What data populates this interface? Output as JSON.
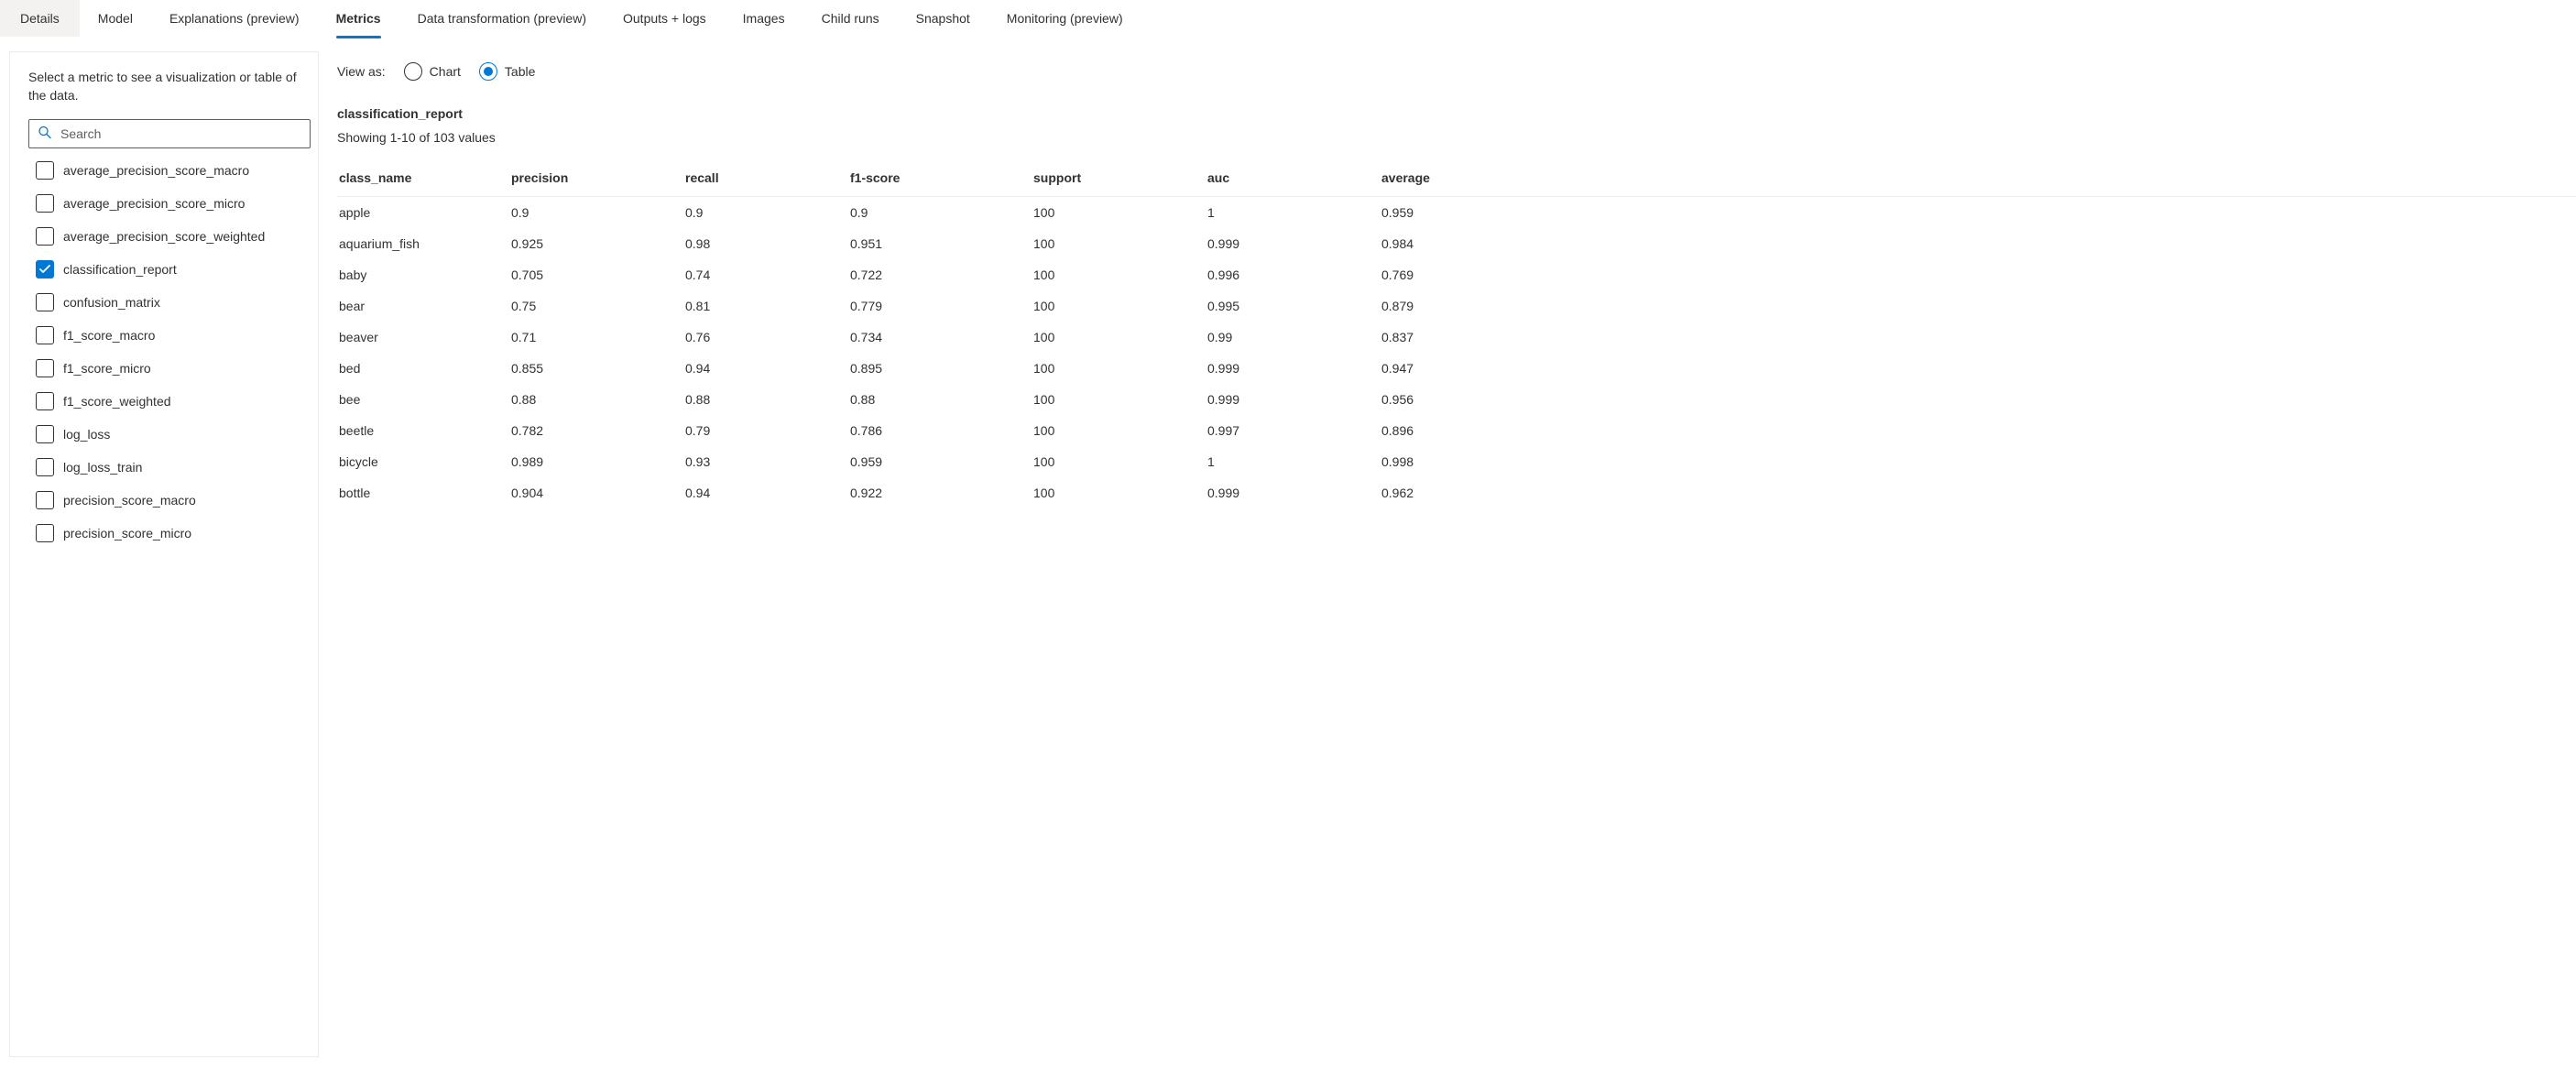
{
  "tabs": [
    {
      "label": "Details",
      "active": false,
      "bg": true
    },
    {
      "label": "Model",
      "active": false
    },
    {
      "label": "Explanations (preview)",
      "active": false
    },
    {
      "label": "Metrics",
      "active": true
    },
    {
      "label": "Data transformation (preview)",
      "active": false
    },
    {
      "label": "Outputs + logs",
      "active": false
    },
    {
      "label": "Images",
      "active": false
    },
    {
      "label": "Child runs",
      "active": false
    },
    {
      "label": "Snapshot",
      "active": false
    },
    {
      "label": "Monitoring (preview)",
      "active": false
    }
  ],
  "sidebar": {
    "title": "Select a metric to see a visualization or table of the data.",
    "search_placeholder": "Search",
    "metrics": [
      {
        "label": "average_precision_score_macro",
        "checked": false
      },
      {
        "label": "average_precision_score_micro",
        "checked": false
      },
      {
        "label": "average_precision_score_weighted",
        "checked": false
      },
      {
        "label": "classification_report",
        "checked": true
      },
      {
        "label": "confusion_matrix",
        "checked": false
      },
      {
        "label": "f1_score_macro",
        "checked": false
      },
      {
        "label": "f1_score_micro",
        "checked": false
      },
      {
        "label": "f1_score_weighted",
        "checked": false
      },
      {
        "label": "log_loss",
        "checked": false
      },
      {
        "label": "log_loss_train",
        "checked": false
      },
      {
        "label": "precision_score_macro",
        "checked": false
      },
      {
        "label": "precision_score_micro",
        "checked": false
      }
    ]
  },
  "main": {
    "viewas_label": "View as:",
    "chart_label": "Chart",
    "table_label": "Table",
    "selected_view": "table",
    "report_title": "classification_report",
    "report_sub": "Showing 1-10 of 103 values",
    "columns": [
      "class_name",
      "precision",
      "recall",
      "f1-score",
      "support",
      "auc",
      "average"
    ],
    "rows": [
      {
        "class_name": "apple",
        "precision": "0.9",
        "recall": "0.9",
        "f1": "0.9",
        "support": "100",
        "auc": "1",
        "avg": "0.959"
      },
      {
        "class_name": "aquarium_fish",
        "precision": "0.925",
        "recall": "0.98",
        "f1": "0.951",
        "support": "100",
        "auc": "0.999",
        "avg": "0.984"
      },
      {
        "class_name": "baby",
        "precision": "0.705",
        "recall": "0.74",
        "f1": "0.722",
        "support": "100",
        "auc": "0.996",
        "avg": "0.769"
      },
      {
        "class_name": "bear",
        "precision": "0.75",
        "recall": "0.81",
        "f1": "0.779",
        "support": "100",
        "auc": "0.995",
        "avg": "0.879"
      },
      {
        "class_name": "beaver",
        "precision": "0.71",
        "recall": "0.76",
        "f1": "0.734",
        "support": "100",
        "auc": "0.99",
        "avg": "0.837"
      },
      {
        "class_name": "bed",
        "precision": "0.855",
        "recall": "0.94",
        "f1": "0.895",
        "support": "100",
        "auc": "0.999",
        "avg": "0.947"
      },
      {
        "class_name": "bee",
        "precision": "0.88",
        "recall": "0.88",
        "f1": "0.88",
        "support": "100",
        "auc": "0.999",
        "avg": "0.956"
      },
      {
        "class_name": "beetle",
        "precision": "0.782",
        "recall": "0.79",
        "f1": "0.786",
        "support": "100",
        "auc": "0.997",
        "avg": "0.896"
      },
      {
        "class_name": "bicycle",
        "precision": "0.989",
        "recall": "0.93",
        "f1": "0.959",
        "support": "100",
        "auc": "1",
        "avg": "0.998"
      },
      {
        "class_name": "bottle",
        "precision": "0.904",
        "recall": "0.94",
        "f1": "0.922",
        "support": "100",
        "auc": "0.999",
        "avg": "0.962"
      }
    ]
  }
}
